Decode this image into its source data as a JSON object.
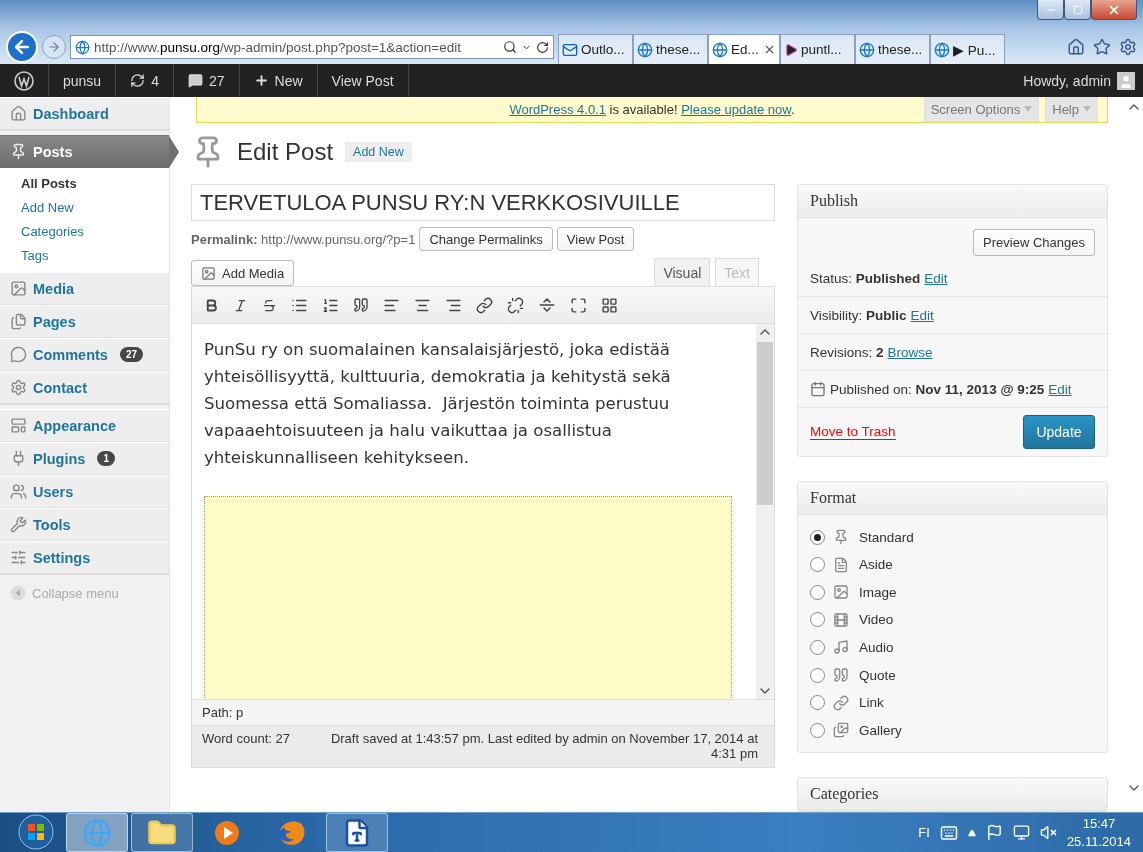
{
  "browser": {
    "address": "http://www.**punsu.org**/wp-admin/post.php?post=1&action=edit",
    "tabs": [
      {
        "kind": "mail",
        "label": "Outlo...",
        "selected": false
      },
      {
        "kind": "web",
        "label": "these...",
        "selected": false
      },
      {
        "kind": "web",
        "label": "Ed...",
        "selected": true
      },
      {
        "kind": "app",
        "label": "puntl...",
        "selected": false
      },
      {
        "kind": "web",
        "label": "these...",
        "selected": false
      },
      {
        "kind": "web",
        "label": "▶ Pu...",
        "selected": false
      }
    ]
  },
  "admin_bar": {
    "items": [
      {
        "kind": "logo"
      },
      {
        "kind": "site",
        "label": "punsu"
      },
      {
        "kind": "updates",
        "label": "4"
      },
      {
        "kind": "comments",
        "label": "27"
      },
      {
        "kind": "new",
        "label": "New"
      },
      {
        "kind": "link",
        "label": "View Post"
      }
    ],
    "account": "Howdy, admin"
  },
  "sidebar": {
    "groups": [
      [
        {
          "kind": "dashboard",
          "label": "Dashboard",
          "selected": false
        }
      ],
      [
        {
          "kind": "posts",
          "label": "Posts",
          "selected": true,
          "submenu": [
            {
              "label": "All Posts",
              "selected": true
            },
            {
              "label": "Add New",
              "selected": false
            },
            {
              "label": "Categories",
              "selected": false
            },
            {
              "label": "Tags",
              "selected": false
            }
          ]
        },
        {
          "kind": "media",
          "label": "Media",
          "selected": false
        },
        {
          "kind": "pages",
          "label": "Pages",
          "selected": false
        },
        {
          "kind": "comments",
          "label": "Comments",
          "selected": false,
          "badge": "27"
        },
        {
          "kind": "contact",
          "label": "Contact",
          "selected": false
        }
      ],
      [
        {
          "kind": "appearance",
          "label": "Appearance",
          "selected": false
        },
        {
          "kind": "plugins",
          "label": "Plugins",
          "selected": false,
          "badge": "1"
        },
        {
          "kind": "users",
          "label": "Users",
          "selected": false
        },
        {
          "kind": "tools",
          "label": "Tools",
          "selected": false
        },
        {
          "kind": "settings",
          "label": "Settings",
          "selected": false
        }
      ]
    ],
    "collapse": "Collapse menu"
  },
  "notice": {
    "parts": [
      {
        "kind": "link",
        "text": "WordPress 4.0.1"
      },
      {
        "kind": "text",
        "text": " is available! "
      },
      {
        "kind": "link",
        "text": "Please update now"
      },
      {
        "kind": "text",
        "text": "."
      }
    ]
  },
  "screen_tabs": [
    "Screen Options",
    "Help"
  ],
  "heading": {
    "title": "Edit Post",
    "add_new": "Add New"
  },
  "post": {
    "title": "TERVETULOA PUNSU RY:N VERKKOSIVUILLE",
    "permalink_label": "Permalink:",
    "permalink": "http://www.punsu.org/?p=1",
    "permalink_buttons": [
      "Change Permalinks",
      "View Post"
    ],
    "add_media": "Add Media",
    "editor_tabs": [
      {
        "label": "Visual",
        "selected": true
      },
      {
        "label": "Text",
        "selected": false
      }
    ],
    "content": "PunSu ry on suomalainen kansalaisjärjestö, joka edistää yhteisöllisyyttä, kulttuuria, demokratia ja kehitystä sekä Suomessa että Somaliassa.  Järjestön toiminta perustuu vapaaehtoisuuteen ja halu vaikuttaa ja osallistua yhteiskunnalliseen kehitykseen.",
    "path": "Path: p",
    "word_count": "Word count: 27",
    "draft_status": "Draft saved at 1:43:57 pm. Last edited by admin on November 17, 2014 at 4:31 pm"
  },
  "publish": {
    "title": "Publish",
    "preview": "Preview Changes",
    "rows": [
      {
        "kind": "plain",
        "label": "Status:",
        "value": "Published",
        "link": "Edit"
      },
      {
        "kind": "plain",
        "label": "Visibility:",
        "value": "Public",
        "link": "Edit"
      },
      {
        "kind": "plain",
        "label": "Revisions:",
        "value": "2",
        "link": "Browse"
      },
      {
        "kind": "date",
        "label": "Published on:",
        "value": "Nov 11, 2013 @ 9:25",
        "link": "Edit"
      }
    ],
    "trash": "Move to Trash",
    "update": "Update"
  },
  "format": {
    "title": "Format",
    "options": [
      {
        "kind": "standard",
        "label": "Standard",
        "selected": true
      },
      {
        "kind": "aside",
        "label": "Aside",
        "selected": false
      },
      {
        "kind": "image",
        "label": "Image",
        "selected": false
      },
      {
        "kind": "video",
        "label": "Video",
        "selected": false
      },
      {
        "kind": "audio",
        "label": "Audio",
        "selected": false
      },
      {
        "kind": "quote",
        "label": "Quote",
        "selected": false
      },
      {
        "kind": "link",
        "label": "Link",
        "selected": false
      },
      {
        "kind": "gallery",
        "label": "Gallery",
        "selected": false
      }
    ]
  },
  "categories": {
    "title": "Categories"
  },
  "taskbar": {
    "apps": [
      {
        "kind": "ie",
        "running": true,
        "selected": true
      },
      {
        "kind": "folder",
        "running": true,
        "selected": false
      },
      {
        "kind": "player",
        "running": false,
        "selected": false
      },
      {
        "kind": "firefox",
        "running": false,
        "selected": false
      },
      {
        "kind": "word",
        "running": true,
        "selected": false
      }
    ],
    "language": "FI",
    "time": "15:47",
    "date": "25.11.2014"
  }
}
